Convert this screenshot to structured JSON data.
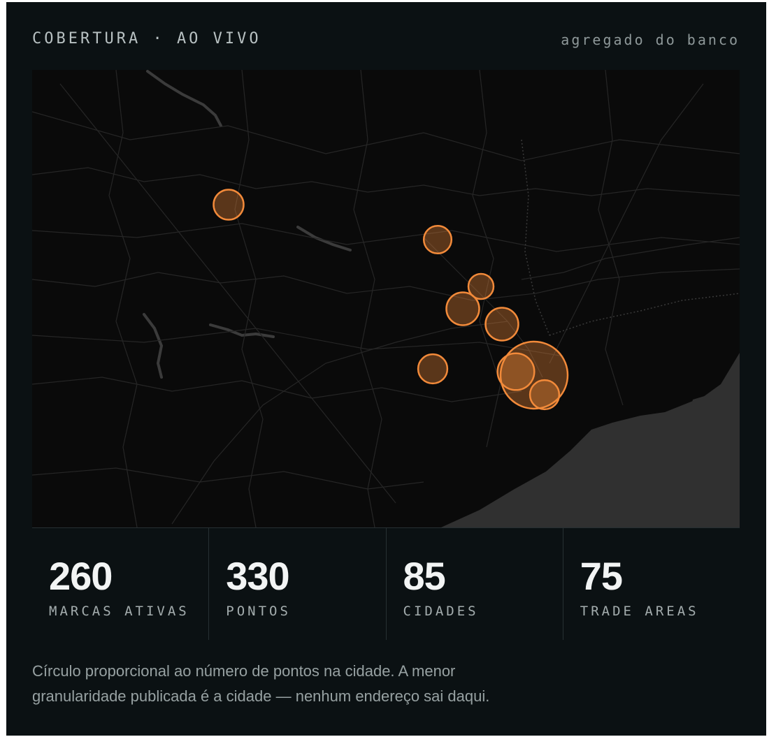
{
  "header": {
    "title": "COBERTURA · AO VIVO",
    "source": "agregado do banco"
  },
  "map": {
    "basemap": "dark",
    "colors": {
      "marker_fill": "#f28a3a",
      "marker_stroke": "#f28a3a",
      "land": "#0a0a0a",
      "sea": "#2f2f2f",
      "roads": "#2a2a2a",
      "rivers": "#3a3a3a"
    },
    "markers": [
      {
        "name": "marker-city-1",
        "relative_points": 0.2
      },
      {
        "name": "marker-city-2",
        "relative_points": 0.17
      },
      {
        "name": "marker-city-3",
        "relative_points": 0.14
      },
      {
        "name": "marker-city-4",
        "relative_points": 0.24
      },
      {
        "name": "marker-city-5",
        "relative_points": 0.24
      },
      {
        "name": "marker-city-6",
        "relative_points": 0.19
      },
      {
        "name": "marker-city-7",
        "relative_points": 1.0
      },
      {
        "name": "marker-city-8",
        "relative_points": 0.3
      },
      {
        "name": "marker-city-9",
        "relative_points": 0.19
      }
    ]
  },
  "stats": [
    {
      "value": "260",
      "label": "MARCAS ATIVAS"
    },
    {
      "value": "330",
      "label": "PONTOS"
    },
    {
      "value": "85",
      "label": "CIDADES"
    },
    {
      "value": "75",
      "label": "TRADE AREAS"
    }
  ],
  "footnote": "Círculo proporcional ao número de pontos na cidade. A menor granularidade publicada é a cidade — nenhum endereço sai daqui."
}
